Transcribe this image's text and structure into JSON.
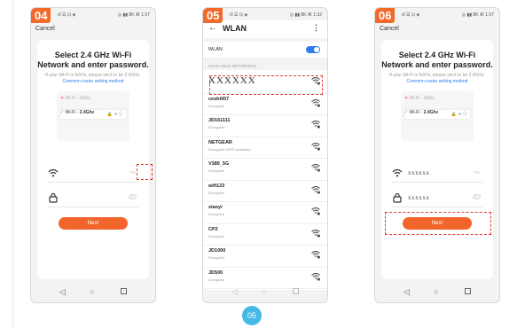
{
  "common": {
    "status_left": "ıll ☰ ⊡ ◈",
    "status_right": "◎ ▮▮ 8K ⌘ 1:37",
    "cancel_label": "Cancel",
    "next_label": "Next"
  },
  "screen1": {
    "step": "04",
    "title_line1": "Select 2.4 GHz Wi-Fi",
    "title_line2": "Network and enter password.",
    "sub_text": "If your Wi-Fi is 5GHz, please set it to be 2.4GHz.",
    "sub_link": "Common router setting method",
    "mini_5g": "Wi-Fi - 5Ghz",
    "mini_24_prefix": "Wi-Fi -",
    "mini_24_bold": "2.4Ghz",
    "ssid_value": "",
    "ssid_hint": "Fer",
    "password_value": ""
  },
  "screen2": {
    "step": "05",
    "title": "WLAN",
    "wlan_label": "WLAN",
    "section_label": "AVAILABLE NETWORKS",
    "networks": [
      {
        "name": "XXXXXX",
        "status": ""
      },
      {
        "name": "ceshi007",
        "status": "Encrypted"
      },
      {
        "name": "JD161111",
        "status": "Encrypted"
      },
      {
        "name": "NETGEAR",
        "status": "Encrypted (WPS available)"
      },
      {
        "name": "V380_5G",
        "status": "Encrypted"
      },
      {
        "name": "wifi123",
        "status": "Encrypted"
      },
      {
        "name": "xiaoyi",
        "status": "Encrypted"
      },
      {
        "name": "CP2",
        "status": "Encrypted"
      },
      {
        "name": "JD1000",
        "status": "Encrypted"
      },
      {
        "name": "JD500",
        "status": "Encrypted"
      }
    ],
    "status_right": "◎ ▮▮ 8K ⌘ 1:32"
  },
  "screen3": {
    "step": "06",
    "title_line1": "Select 2.4 GHz Wi-Fi",
    "title_line2": "Network and enter password.",
    "sub_text": "If your Wi-Fi is 5GHz, please set it to be 2.4GHz.",
    "sub_link": "Common router setting method",
    "mini_5g": "Wi-Fi - 5Ghz",
    "mini_24_prefix": "Wi-Fi -",
    "mini_24_bold": "2.4Ghz",
    "ssid_value": "xxxxxx",
    "ssid_hint": "Fer",
    "password_value": "xxxxxx"
  },
  "pager": {
    "current": "05"
  },
  "colors": {
    "accent": "#f2652a",
    "link": "#2b7de9",
    "highlight": "#e53b2e",
    "pager": "#45b8e8"
  }
}
